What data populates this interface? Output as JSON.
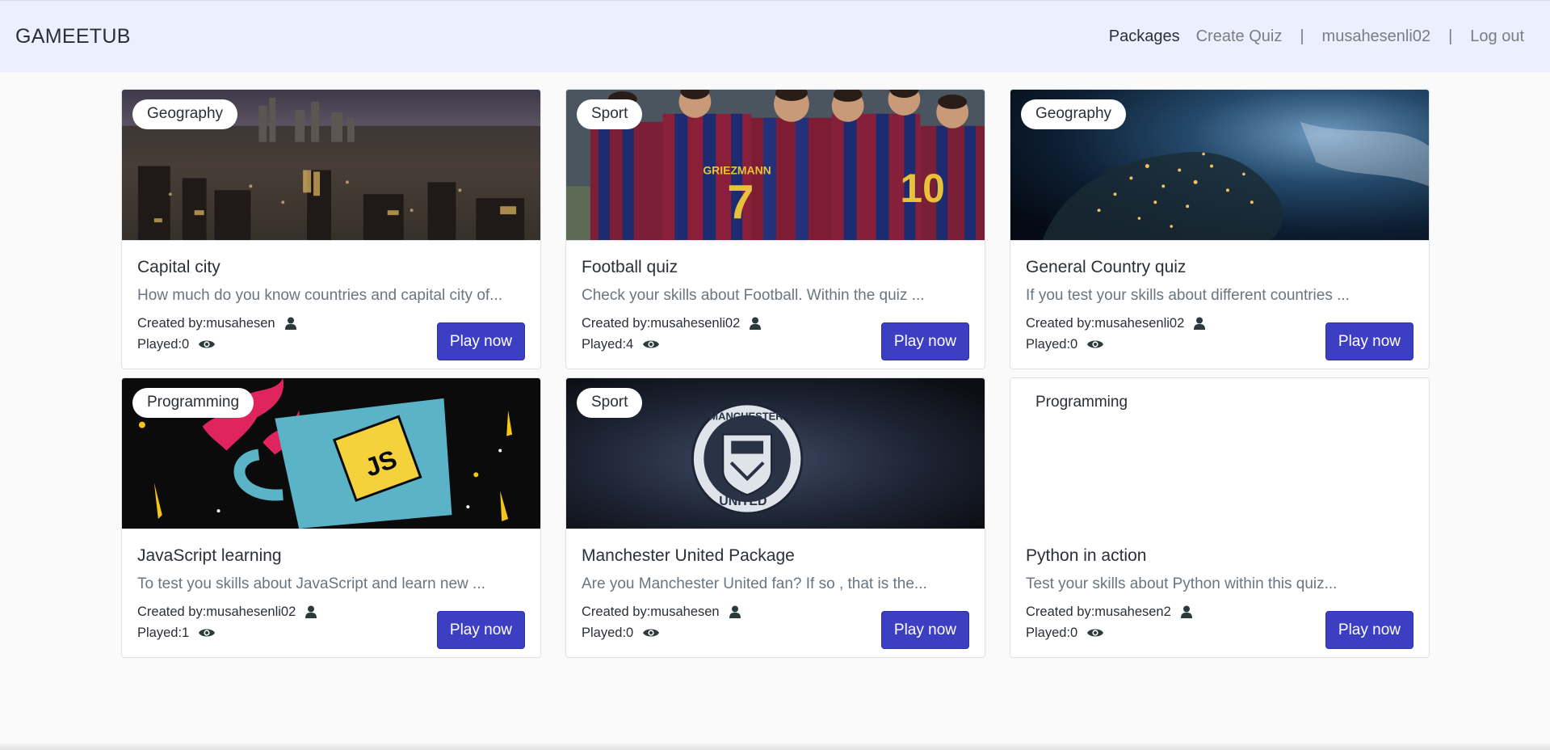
{
  "navbar": {
    "brand": "GAMEETUB",
    "links": {
      "packages": "Packages",
      "create_quiz": "Create Quiz",
      "user": "musahesenli02",
      "logout": "Log out",
      "separator": "|"
    }
  },
  "labels": {
    "created_prefix": "Created by: ",
    "played_prefix": "Played: ",
    "play_button": "Play now"
  },
  "cards": [
    {
      "category": "Geography",
      "title": "Capital city",
      "description": "How much do you know countries and capital city of...",
      "creator": "musahesen",
      "played": "0",
      "image": "city-skyline"
    },
    {
      "category": "Sport",
      "title": "Football quiz",
      "description": "Check your skills about Football. Within the quiz ...",
      "creator": "musahesenli02",
      "played": "4",
      "image": "football-team"
    },
    {
      "category": "Geography",
      "title": "General Country quiz",
      "description": "If you test your skills about different countries ...",
      "creator": "musahesenli02",
      "played": "0",
      "image": "earth-night"
    },
    {
      "category": "Programming",
      "title": "JavaScript learning",
      "description": "To test you skills about JavaScript and learn new ...",
      "creator": "musahesenli02",
      "played": "1",
      "image": "js-mug"
    },
    {
      "category": "Sport",
      "title": "Manchester United Package",
      "description": "Are you Manchester United fan? If so , that is the...",
      "creator": "musahesen",
      "played": "0",
      "image": "manchester-united-crest"
    },
    {
      "category": "Programming",
      "title": "Python in action",
      "description": "Test your skills about Python within this quiz...",
      "creator": "musahesen2",
      "played": "0",
      "image": ""
    }
  ],
  "badge_texts": {
    "crest_top": "MANCHESTER",
    "crest_bottom": "UNITED",
    "mug_text": "JS",
    "jersey_text": "GRIEZMANN"
  },
  "icons": {
    "creator": "user-icon",
    "played": "eye-icon"
  }
}
